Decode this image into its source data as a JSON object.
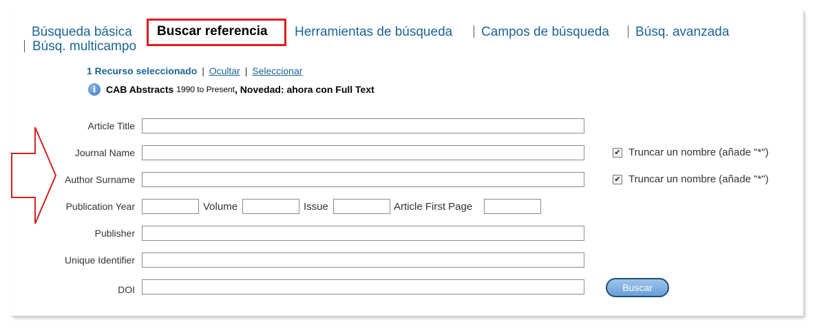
{
  "tabs": [
    {
      "label": "Búsqueda básica",
      "active": false
    },
    {
      "label": "Buscar referencia",
      "active": true
    },
    {
      "label": "Herramientas de búsqueda",
      "active": false
    },
    {
      "label": "Campos de búsqueda",
      "active": false
    },
    {
      "label": "Búsq. avanzada",
      "active": false
    },
    {
      "label": "Búsq. multicampo",
      "active": false
    }
  ],
  "resources": {
    "selected": "1 Recurso seleccionado",
    "hide": "Ocultar",
    "select": "Seleccionar",
    "separator": "|"
  },
  "database": {
    "icon": "info-icon",
    "name": "CAB Abstracts",
    "range": "1990 to Present",
    "news": ", Novedad: ahora con Full Text"
  },
  "form": {
    "article_title": {
      "label": "Article Title",
      "value": ""
    },
    "journal_name": {
      "label": "Journal Name",
      "value": ""
    },
    "author_surname": {
      "label": "Author Surname",
      "value": ""
    },
    "publication_year": {
      "label": "Publication Year",
      "value": ""
    },
    "volume": {
      "label": "Volume",
      "value": ""
    },
    "issue": {
      "label": "Issue",
      "value": ""
    },
    "first_page": {
      "label": "Article First Page",
      "value": ""
    },
    "publisher": {
      "label": "Publisher",
      "value": ""
    },
    "unique_identifier": {
      "label": "Unique Identifier",
      "value": ""
    },
    "doi": {
      "label": "DOI",
      "value": ""
    },
    "truncate_label": "Truncar un nombre (añade \"*\")",
    "truncate_journal_checked": true,
    "truncate_author_checked": true,
    "search_button": "Buscar"
  },
  "colors": {
    "link": "#1a6496",
    "highlight": "#e01b1b",
    "annotation_arrow": "#d42020"
  }
}
